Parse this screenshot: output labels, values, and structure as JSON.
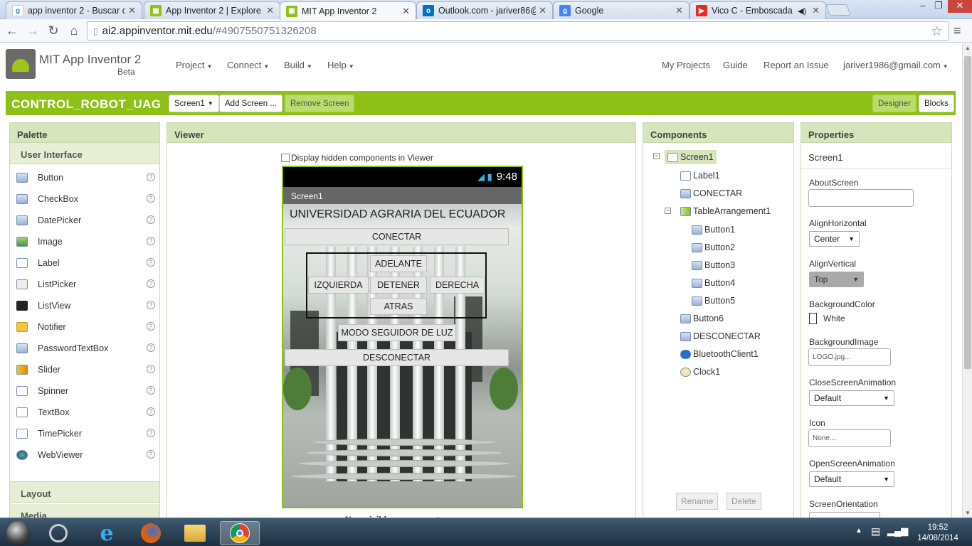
{
  "browser": {
    "tabs": [
      {
        "title": "app inventor 2 - Buscar co",
        "icon": "google-search-icon"
      },
      {
        "title": "App Inventor 2 | Explore M",
        "icon": "appinventor-icon"
      },
      {
        "title": "MIT App Inventor 2",
        "icon": "appinventor-icon",
        "active": true
      },
      {
        "title": "Outlook.com - jariver86@",
        "icon": "outlook-icon"
      },
      {
        "title": "Google",
        "icon": "google-icon"
      },
      {
        "title": "Vico C - Emboscada - \\",
        "icon": "youtube-icon"
      }
    ],
    "url_host": "ai2.appinventor.mit.edu",
    "url_path": "/#4907550751326208"
  },
  "header": {
    "brand": "MIT App Inventor 2",
    "beta": "Beta",
    "menus": [
      "Project",
      "Connect",
      "Build",
      "Help"
    ],
    "right_links": [
      "My Projects",
      "Guide",
      "Report an Issue"
    ],
    "user": "jariver1986@gmail.com"
  },
  "projectbar": {
    "name": "CONTROL_ROBOT_UAG",
    "screen_select": "Screen1",
    "add_screen": "Add Screen ...",
    "remove_screen": "Remove Screen",
    "designer": "Designer",
    "blocks": "Blocks"
  },
  "palette": {
    "title": "Palette",
    "section": "User Interface",
    "items": [
      "Button",
      "CheckBox",
      "DatePicker",
      "Image",
      "Label",
      "ListPicker",
      "ListView",
      "Notifier",
      "PasswordTextBox",
      "Slider",
      "Spinner",
      "TextBox",
      "TimePicker",
      "WebViewer"
    ],
    "layout": "Layout",
    "media": "Media"
  },
  "viewer": {
    "title": "Viewer",
    "hidden_label": "Display hidden components in Viewer",
    "phone_time": "9:48",
    "screen_title": "Screen1",
    "label1": "UNIVERSIDAD AGRARIA DEL ECUADOR",
    "conectar": "CONECTAR",
    "adelante": "ADELANTE",
    "izquierda": "IZQUIERDA",
    "detener": "DETENER",
    "derecha": "DERECHA",
    "atras": "ATRAS",
    "modo": "MODO SEGUIDOR DE LUZ",
    "desconectar": "DESCONECTAR",
    "nonvisible": "Non-visible components"
  },
  "components": {
    "title": "Components",
    "tree": [
      "Screen1",
      "Label1",
      "CONECTAR",
      "TableArrangement1",
      "Button1",
      "Button2",
      "Button3",
      "Button4",
      "Button5",
      "Button6",
      "DESCONECTAR",
      "BluetoothClient1",
      "Clock1"
    ],
    "rename": "Rename",
    "delete": "Delete"
  },
  "properties": {
    "title": "Properties",
    "component": "Screen1",
    "about_label": "AboutScreen",
    "alignh_label": "AlignHorizontal",
    "alignh_value": "Center",
    "alignv_label": "AlignVertical",
    "alignv_value": "Top",
    "bg_label": "BackgroundColor",
    "bg_value": "White",
    "bgimg_label": "BackgroundImage",
    "bgimg_value": "LOGO.jpg...",
    "close_label": "CloseScreenAnimation",
    "close_value": "Default",
    "icon_label": "Icon",
    "icon_value": "None...",
    "open_label": "OpenScreenAnimation",
    "open_value": "Default",
    "orient_label": "ScreenOrientation"
  },
  "taskbar": {
    "time": "19:52",
    "date": "14/08/2014"
  }
}
